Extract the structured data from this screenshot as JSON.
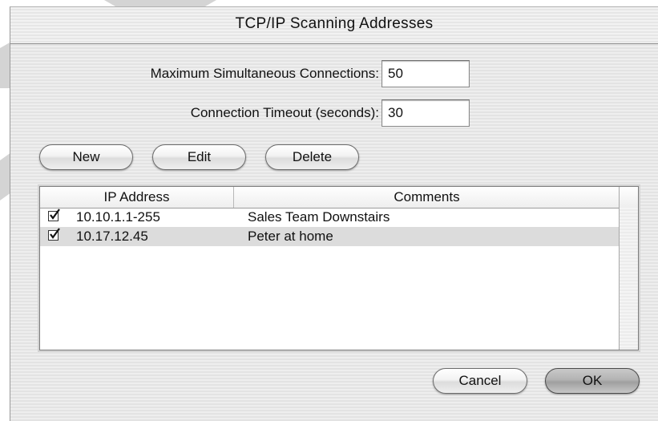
{
  "window": {
    "title": "TCP/IP Scanning Addresses"
  },
  "fields": {
    "max_connections_label": "Maximum Simultaneous Connections:",
    "max_connections_value": "50",
    "timeout_label": "Connection Timeout (seconds):",
    "timeout_value": "30"
  },
  "buttons": {
    "new": "New",
    "edit": "Edit",
    "delete": "Delete",
    "cancel": "Cancel",
    "ok": "OK"
  },
  "table": {
    "columns": [
      "IP Address",
      "Comments"
    ],
    "rows": [
      {
        "checked": true,
        "ip": "10.10.1.1-255",
        "comment": "Sales Team Downstairs"
      },
      {
        "checked": true,
        "ip": "10.17.12.45",
        "comment": "Peter at home"
      }
    ]
  },
  "colors": {
    "selected_row": "#dcdcdc",
    "default_button": "#b3b3b3"
  }
}
